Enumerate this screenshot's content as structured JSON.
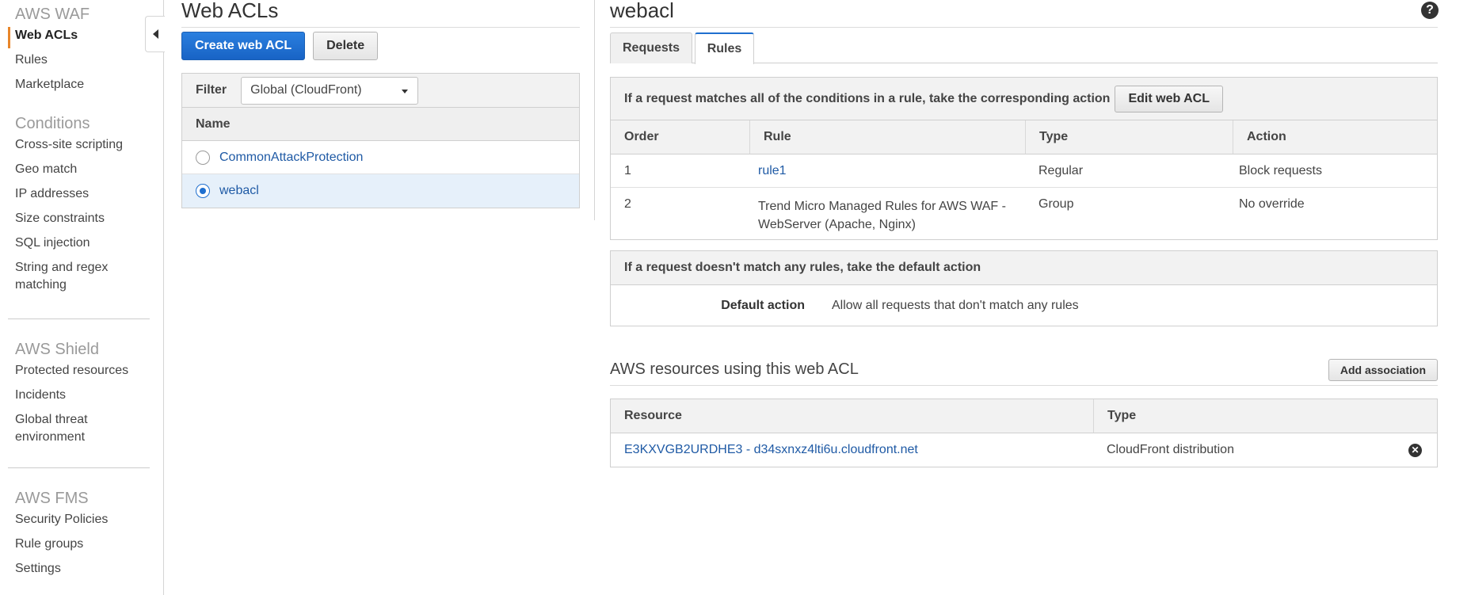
{
  "sidebar": {
    "sections": [
      {
        "title": "AWS WAF",
        "items": [
          {
            "label": "Web ACLs",
            "active": true
          },
          {
            "label": "Rules"
          },
          {
            "label": "Marketplace"
          }
        ]
      },
      {
        "title": "Conditions",
        "items": [
          {
            "label": "Cross-site scripting"
          },
          {
            "label": "Geo match"
          },
          {
            "label": "IP addresses"
          },
          {
            "label": "Size constraints"
          },
          {
            "label": "SQL injection"
          },
          {
            "label": "String and regex matching"
          }
        ]
      },
      {
        "title": "AWS Shield",
        "items": [
          {
            "label": "Protected resources"
          },
          {
            "label": "Incidents"
          },
          {
            "label": "Global threat environment"
          }
        ]
      },
      {
        "title": "AWS FMS",
        "items": [
          {
            "label": "Security Policies"
          },
          {
            "label": "Rule groups"
          },
          {
            "label": "Settings"
          }
        ]
      }
    ]
  },
  "acls": {
    "title": "Web ACLs",
    "create_label": "Create web ACL",
    "delete_label": "Delete",
    "filter_label": "Filter",
    "filter_value": "Global (CloudFront)",
    "name_header": "Name",
    "rows": [
      {
        "name": "CommonAttackProtection",
        "selected": false
      },
      {
        "name": "webacl",
        "selected": true
      }
    ]
  },
  "detail": {
    "title": "webacl",
    "help_icon": "question-circle-icon",
    "tabs": [
      {
        "label": "Requests",
        "active": false
      },
      {
        "label": "Rules",
        "active": true
      }
    ],
    "rules_box": {
      "header": "If a request matches all of the conditions in a rule, take the corresponding action",
      "edit_label": "Edit web ACL",
      "columns": [
        "Order",
        "Rule",
        "Type",
        "Action"
      ],
      "rows": [
        {
          "order": "1",
          "rule": "rule1",
          "type": "Regular",
          "action": "Block requests",
          "is_link": true
        },
        {
          "order": "2",
          "rule": "Trend Micro Managed Rules for AWS WAF - WebServer (Apache, Nginx)",
          "type": "Group",
          "action": "No override",
          "is_link": false
        }
      ]
    },
    "default_box": {
      "header": "If a request doesn't match any rules, take the default action",
      "label": "Default action",
      "value": "Allow all requests that don't match any rules"
    },
    "resources": {
      "title": "AWS resources using this web ACL",
      "add_label": "Add association",
      "columns": [
        "Resource",
        "Type"
      ],
      "rows": [
        {
          "resource": "E3KXVGB2URDHE3 - d34sxnxz4lti6u.cloudfront.net",
          "type": "CloudFront distribution",
          "remove_icon": "remove-circle-icon"
        }
      ]
    }
  }
}
